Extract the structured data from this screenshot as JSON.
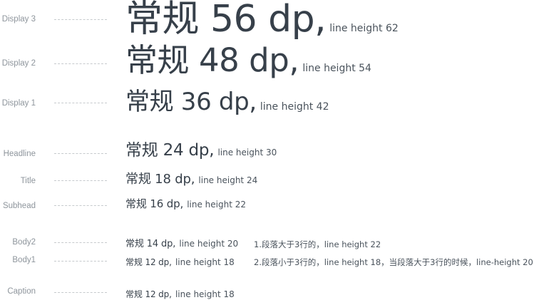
{
  "rows": [
    {
      "label": "Display 3",
      "main": "常规 56 dp,",
      "lh": "line height 62"
    },
    {
      "label": "Display 2",
      "main": "常规 48 dp,",
      "lh": "line height 54"
    },
    {
      "label": "Display 1",
      "main": "常规 36 dp,",
      "lh": "line height 42"
    },
    {
      "label": "Headline",
      "main": "常规 24 dp,",
      "lh": "line height 30"
    },
    {
      "label": "Title",
      "main": "常规 18 dp,",
      "lh": "line height 24"
    },
    {
      "label": "Subhead",
      "main": "常规 16 dp,",
      "lh": "line height 22"
    },
    {
      "label": "Body2",
      "main": "常规 14 dp,",
      "lh": "line height 20"
    },
    {
      "label": "Body1",
      "main": "常规 12 dp,",
      "lh": "line height 18"
    },
    {
      "label": "Caption",
      "main": "常规 12 dp,",
      "lh": "line height 18"
    }
  ],
  "notes": [
    "1.段落大于3行的，line height 22",
    "2.段落小于3行的，line height 18，当段落大于3行的时候，line-height 20"
  ]
}
